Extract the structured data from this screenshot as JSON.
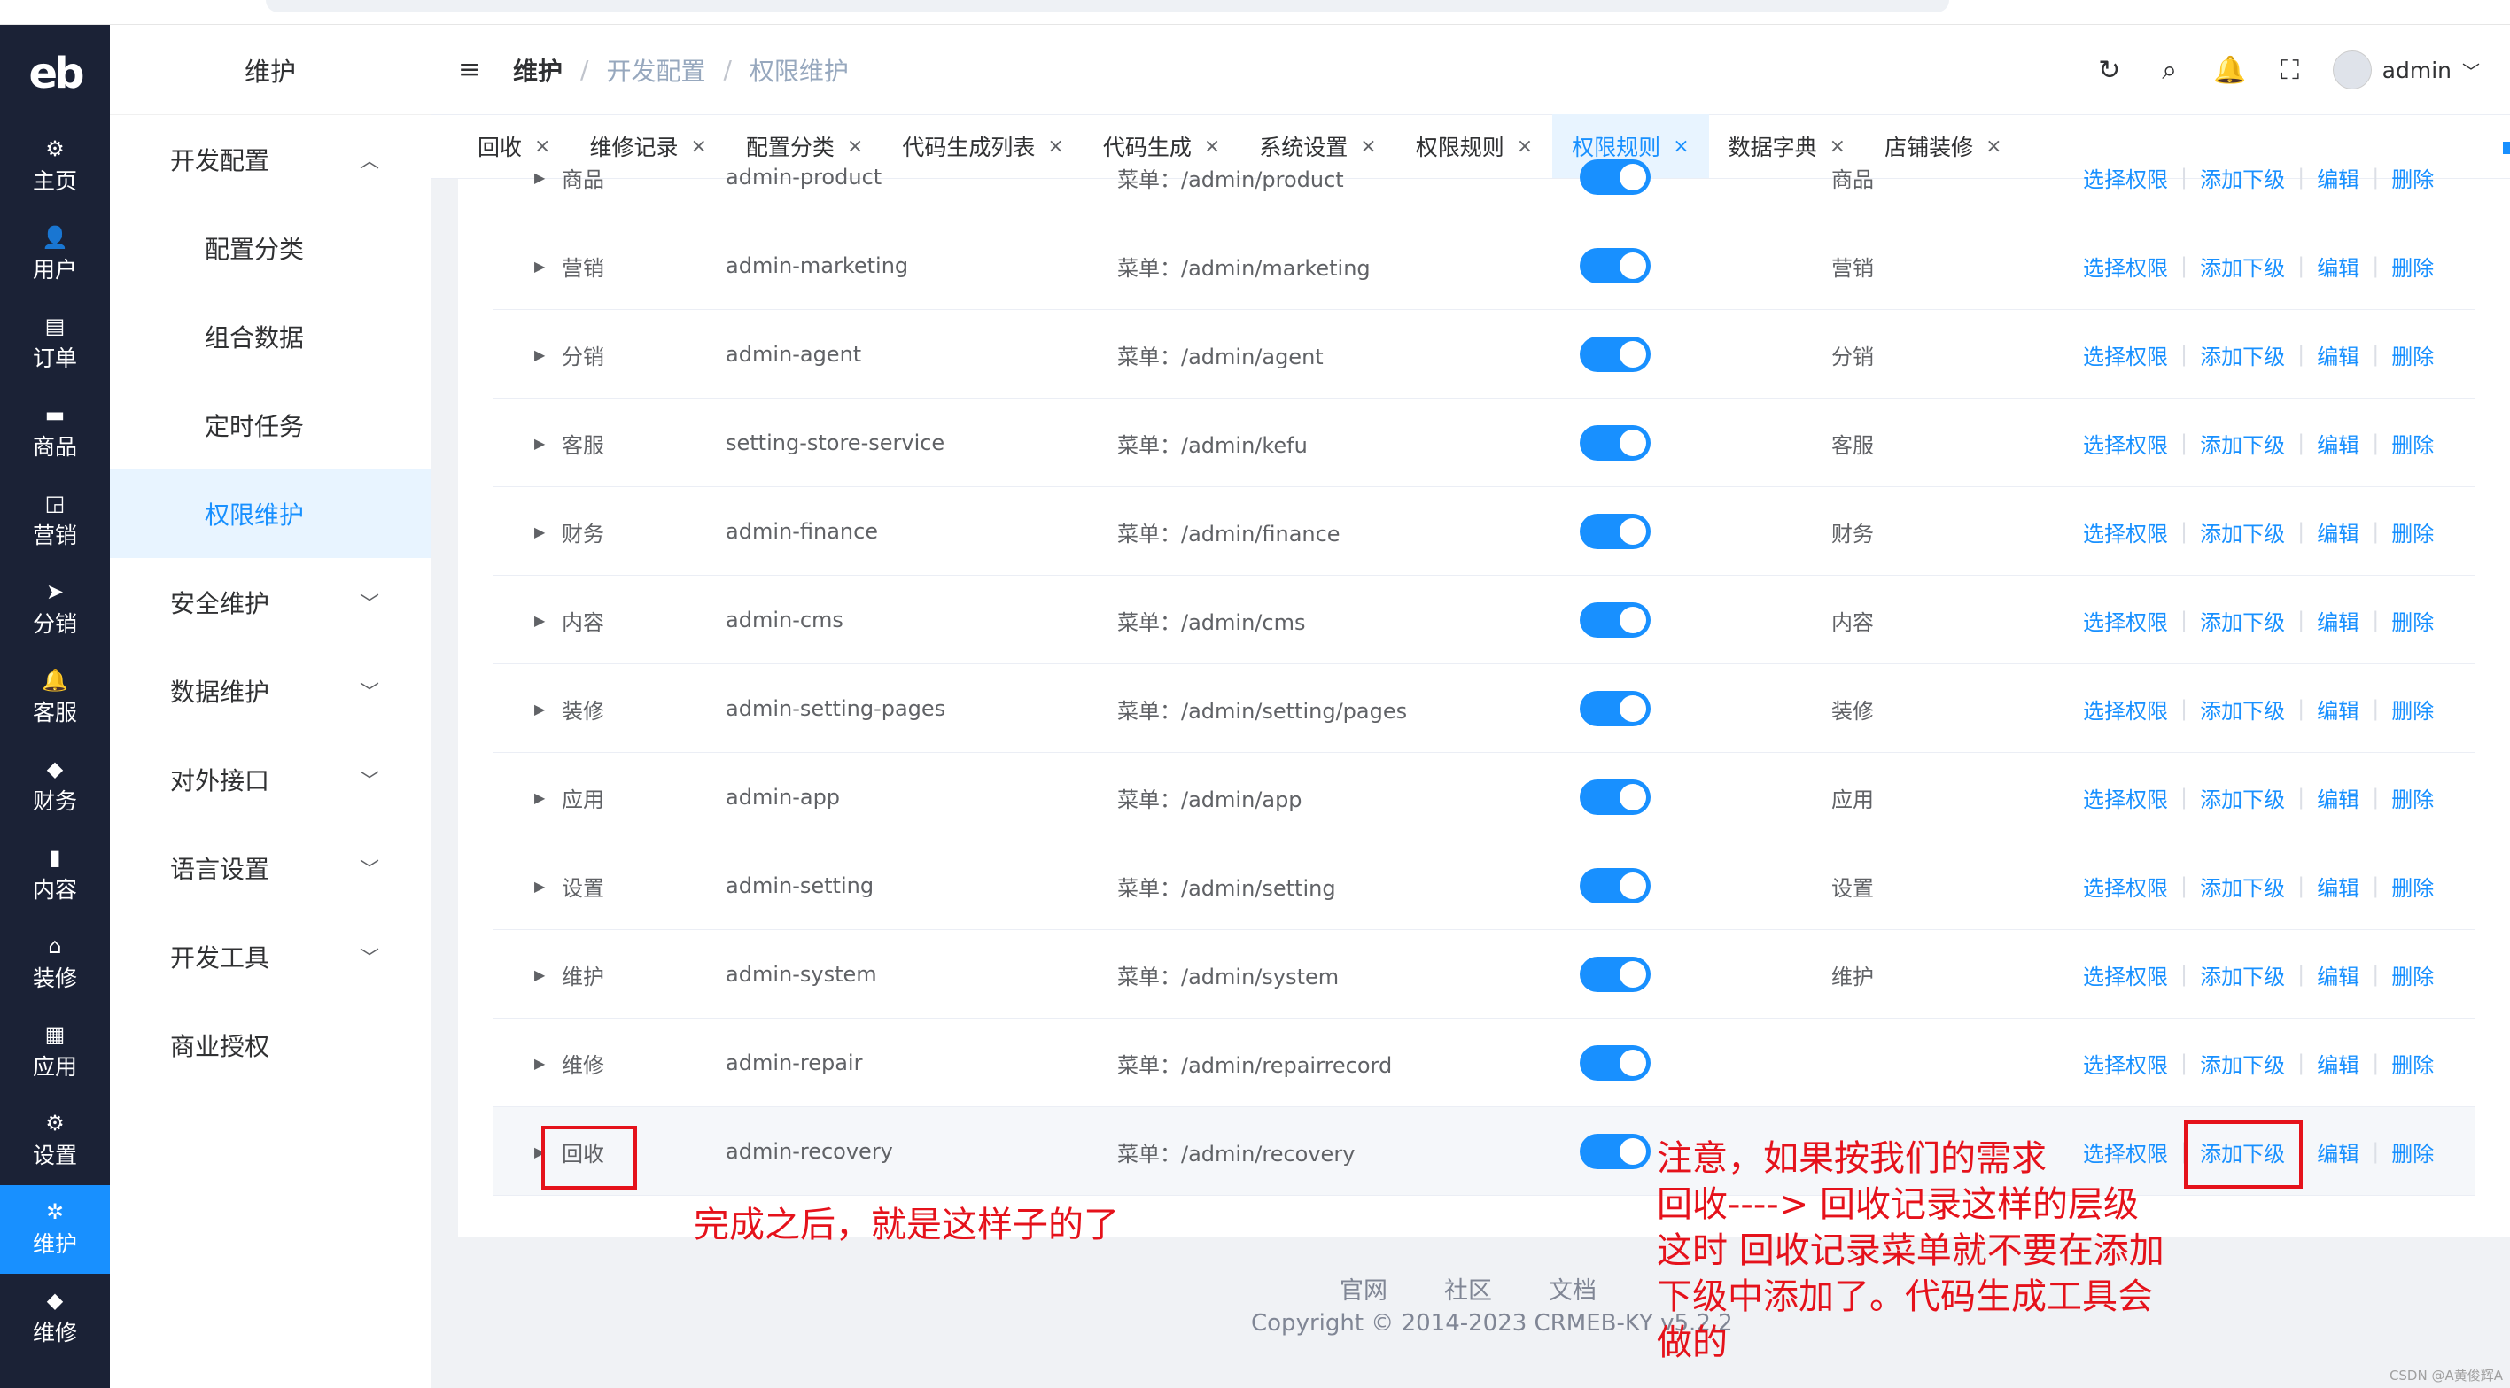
{
  "rail": {
    "logo": "eb",
    "items": [
      {
        "icon": "⚙",
        "label": "主页"
      },
      {
        "icon": "👤",
        "label": "用户"
      },
      {
        "icon": "▤",
        "label": "订单"
      },
      {
        "icon": "▬",
        "label": "商品"
      },
      {
        "icon": "◲",
        "label": "营销"
      },
      {
        "icon": "➤",
        "label": "分销"
      },
      {
        "icon": "🔔",
        "label": "客服"
      },
      {
        "icon": "◆",
        "label": "财务"
      },
      {
        "icon": "▮",
        "label": "内容"
      },
      {
        "icon": "⌂",
        "label": "装修"
      },
      {
        "icon": "▦",
        "label": "应用"
      },
      {
        "icon": "⚙",
        "label": "设置"
      },
      {
        "icon": "✲",
        "label": "维护"
      },
      {
        "icon": "◆",
        "label": "维修"
      }
    ]
  },
  "submenu": {
    "title": "维护",
    "items": [
      {
        "label": "开发配置",
        "chev": "︿"
      },
      {
        "label": "配置分类"
      },
      {
        "label": "组合数据"
      },
      {
        "label": "定时任务"
      },
      {
        "label": "权限维护"
      },
      {
        "label": "安全维护",
        "chev": "﹀"
      },
      {
        "label": "数据维护",
        "chev": "﹀"
      },
      {
        "label": "对外接口",
        "chev": "﹀"
      },
      {
        "label": "语言设置",
        "chev": "﹀"
      },
      {
        "label": "开发工具",
        "chev": "﹀"
      },
      {
        "label": "商业授权"
      }
    ]
  },
  "header": {
    "menu_icon": "≡",
    "crumbs": [
      "维护",
      "开发配置",
      "权限维护"
    ],
    "sep": "/",
    "icons": [
      "↻",
      "⌕",
      "🔔",
      "⛶"
    ],
    "user": "admin",
    "user_chev": "﹀"
  },
  "tabs": [
    {
      "label": "回收"
    },
    {
      "label": "维修记录"
    },
    {
      "label": "配置分类"
    },
    {
      "label": "代码生成列表"
    },
    {
      "label": "代码生成"
    },
    {
      "label": "系统设置"
    },
    {
      "label": "权限规则"
    },
    {
      "label": "权限规则"
    },
    {
      "label": "数据字典"
    },
    {
      "label": "店铺装修"
    }
  ],
  "tab_close": "×",
  "table": {
    "arrow": "▶",
    "ops": [
      "选择权限",
      "添加下级",
      "编辑",
      "删除"
    ],
    "ops_sep": "|",
    "rows": [
      {
        "name": "商品",
        "code": "admin-product",
        "path": "菜单：/admin/product",
        "title": "商品"
      },
      {
        "name": "营销",
        "code": "admin-marketing",
        "path": "菜单：/admin/marketing",
        "title": "营销"
      },
      {
        "name": "分销",
        "code": "admin-agent",
        "path": "菜单：/admin/agent",
        "title": "分销"
      },
      {
        "name": "客服",
        "code": "setting-store-service",
        "path": "菜单：/admin/kefu",
        "title": "客服"
      },
      {
        "name": "财务",
        "code": "admin-finance",
        "path": "菜单：/admin/finance",
        "title": "财务"
      },
      {
        "name": "内容",
        "code": "admin-cms",
        "path": "菜单：/admin/cms",
        "title": "内容"
      },
      {
        "name": "装修",
        "code": "admin-setting-pages",
        "path": "菜单：/admin/setting/pages",
        "title": "装修"
      },
      {
        "name": "应用",
        "code": "admin-app",
        "path": "菜单：/admin/app",
        "title": "应用"
      },
      {
        "name": "设置",
        "code": "admin-setting",
        "path": "菜单：/admin/setting",
        "title": "设置"
      },
      {
        "name": "维护",
        "code": "admin-system",
        "path": "菜单：/admin/system",
        "title": "维护"
      },
      {
        "name": "维修",
        "code": "admin-repair",
        "path": "菜单：/admin/repairrecord",
        "title": ""
      },
      {
        "name": "回收",
        "code": "admin-recovery",
        "path": "菜单：/admin/recovery",
        "title": ""
      }
    ]
  },
  "footer": {
    "links": [
      "官网",
      "社区",
      "文档"
    ],
    "copyright": "Copyright © 2014-2023 CRMEB-KY v5.2.2"
  },
  "annotations": {
    "done_text": "完成之后，就是这样子的了",
    "note_text": "注意，如果按我们的需求\n回收----> 回收记录这样的层级\n这时 回收记录菜单就不要在添加\n下级中添加了。代码生成工具会\n做的",
    "color": "#e5121b"
  },
  "watermark": "CSDN @A黄俊辉A"
}
